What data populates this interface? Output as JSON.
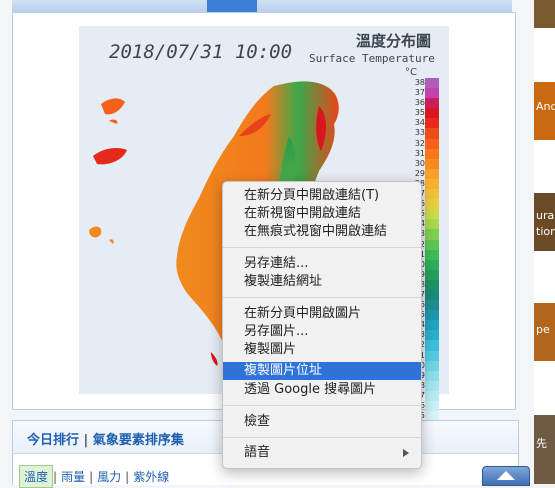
{
  "map": {
    "datetime": "2018/07/31 10:00",
    "title_cn": "溫度分布圖",
    "title_en": "Surface Temperature",
    "unit": "°C",
    "legend_labels": [
      "38",
      "37",
      "36",
      "35",
      "34",
      "33",
      "32",
      "31",
      "30",
      "29",
      "28",
      "27",
      "26",
      "25",
      "24",
      "23",
      "22",
      "21",
      "20",
      "19",
      "18",
      "17",
      "16",
      "15",
      "14",
      "13",
      "12",
      "11",
      "10",
      "9",
      "8",
      "7",
      "6",
      "5",
      "4",
      "3",
      "2",
      "1"
    ],
    "legend_colors": [
      "#b05fb8",
      "#c043b0",
      "#c81e5a",
      "#d8161e",
      "#e6291a",
      "#ef4a1a",
      "#f5611a",
      "#f7781a",
      "#f98a20",
      "#f99f2a",
      "#f8b030",
      "#f2c23a",
      "#e7d044",
      "#cfd94a",
      "#a9d94e",
      "#80cf52",
      "#5fc653",
      "#3fbb56",
      "#2fae5a",
      "#22a05e",
      "#1d9362",
      "#1c8a7a",
      "#1d8f93",
      "#1f98ac",
      "#22a3c0",
      "#2ab1cf",
      "#3ebfd9",
      "#55cbe0",
      "#6fd6e6",
      "#8adfeb",
      "#a2e6ef",
      "#b7ecf2",
      "#c8f0f5",
      "#d6f3f7",
      "#e1f6f9",
      "#eaf8fb",
      "#f2fbfc",
      "#f7fdfd"
    ]
  },
  "ranking": {
    "title_left": "今日排行",
    "divider": "|",
    "title_right": "氣象要素排序集",
    "subtabs": [
      "溫度",
      "雨量",
      "風力",
      "紫外線"
    ]
  },
  "right_strip": [
    "And",
    "ura",
    "tion",
    "pe",
    "先"
  ],
  "context_menu": {
    "items": [
      "在新分頁中開啟連結(T)",
      "在新視窗中開啟連結",
      "在無痕式視窗中開啟連結",
      "另存連結...",
      "複製連結網址",
      "在新分頁中開啟圖片",
      "另存圖片...",
      "複製圖片",
      "複製圖片位址",
      "透過 Google 搜尋圖片",
      "檢查",
      "語音"
    ]
  },
  "colors": {
    "menu_highlight": "#2f73d9",
    "link_blue": "#1d5fb0"
  }
}
